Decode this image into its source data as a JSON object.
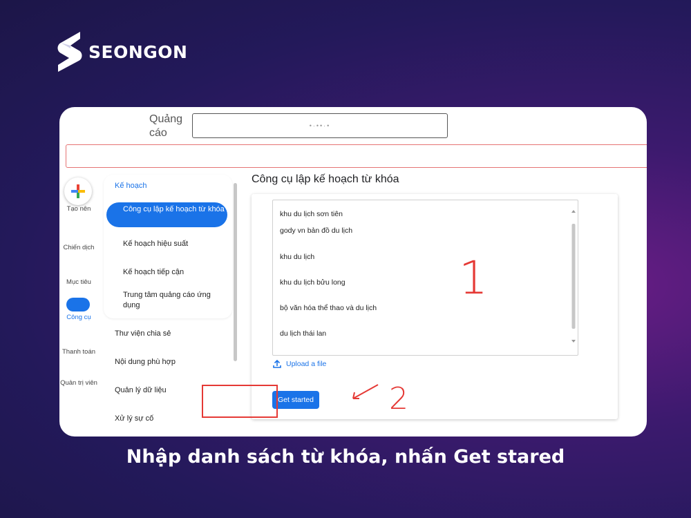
{
  "brand": {
    "name": "SEONGON"
  },
  "header": {
    "label": "Quảng cáo",
    "account_masked": "•·••·•"
  },
  "rail": {
    "create": "Tạo nên",
    "campaigns": "Chiến dịch",
    "goals": "Mục tiêu",
    "tools": "Công cụ",
    "billing": "Thanh toán",
    "admin": "Quản trị viên"
  },
  "nav": {
    "section": "Kế hoạch",
    "items": [
      "Công cụ lập kế hoạch từ khóa",
      "Kế hoạch hiệu suất",
      "Kế hoạch tiếp cận",
      "Trung tâm quảng cáo ứng dụng"
    ],
    "more": [
      "Thư viện chia sẻ",
      "Nội dung phù hợp",
      "Quản lý dữ liệu",
      "Xử lý sự cố"
    ]
  },
  "main": {
    "title": "Công cụ lập kế hoạch từ khóa",
    "keywords": [
      "khu du lịch sơn tiên",
      "gody vn bản đồ du lịch",
      "khu du lịch",
      "khu du lịch bửu long",
      "bộ văn hóa thể thao và du lịch",
      "du lịch thái lan"
    ],
    "upload": "Upload a file",
    "button": "Get started"
  },
  "annotations": {
    "step1": "1",
    "step2": "2"
  },
  "caption": "Nhập danh sách từ khóa, nhấn Get stared",
  "colors": {
    "accent": "#1a73e8",
    "annotation": "#e53935"
  }
}
